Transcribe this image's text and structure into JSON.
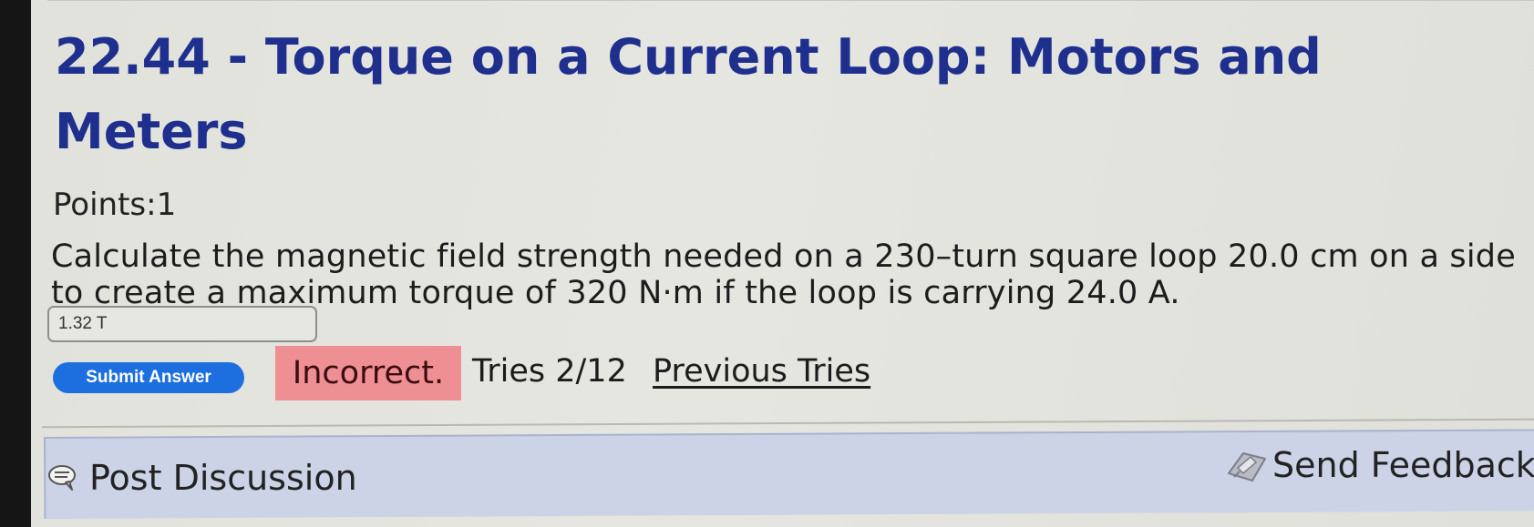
{
  "problem": {
    "title": "22.44 - Torque on a Current Loop: Motors and Meters",
    "points_label": "Points:",
    "points_value": "1",
    "question": "Calculate the magnetic field strength needed on a 230–turn square loop 20.0 cm on a side to create a maximum torque of 320 N·m if the loop is carrying 24.0 A.",
    "answer_value": "1.32 T"
  },
  "actions": {
    "submit_label": "Submit Answer",
    "result_label": "Incorrect.",
    "tries_text": "Tries 2/12",
    "previous_tries_label": "Previous Tries"
  },
  "footer": {
    "post_discussion_label": "Post Discussion",
    "send_feedback_label": "Send Feedback",
    "post_discussion_icon": "chat-bubble-icon",
    "send_feedback_icon": "pencil-feedback-icon"
  },
  "colors": {
    "title": "#1f2f8e",
    "submit_button": "#1d6fe0",
    "incorrect_badge": "#ee8f93",
    "discussion_bar": "#ccd3e6"
  }
}
